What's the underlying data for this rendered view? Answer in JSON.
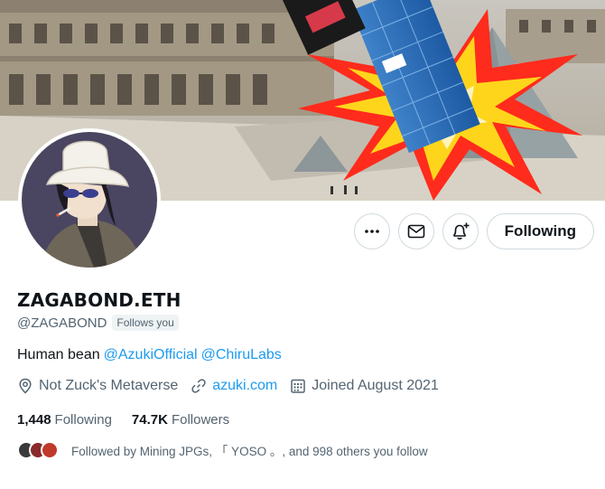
{
  "profile": {
    "display_name": "ZAGABOND.ETH",
    "handle": "@ZAGABOND",
    "follows_you": "Follows you",
    "bio_text": "Human bean",
    "bio_mentions": [
      "@AzukiOfficial",
      "@ChiruLabs"
    ],
    "location": "Not Zuck's Metaverse",
    "website": "azuki.com",
    "joined": "Joined August 2021"
  },
  "stats": {
    "following_count": "1,448",
    "following_label": "Following",
    "followers_count": "74.7K",
    "followers_label": "Followers"
  },
  "followed_by": "Followed by Mining JPGs, 「 YOSO 。, and 998 others you follow",
  "actions": {
    "more_icon": "more-icon",
    "message_icon": "envelope-icon",
    "notify_icon": "bell-plus-icon",
    "follow_label": "Following"
  },
  "colors": {
    "accent": "#1d9bf0",
    "text": "#0f1419",
    "secondary": "#536471",
    "border": "#cfd9de",
    "burst": "#ff2b1c"
  }
}
